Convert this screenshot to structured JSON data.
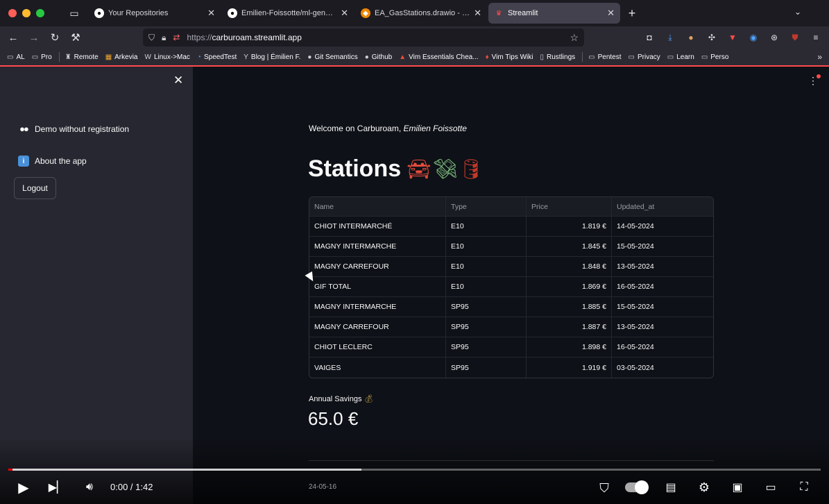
{
  "browser": {
    "tabs": [
      {
        "title": "Your Repositories",
        "icon": "github-icon",
        "active": false
      },
      {
        "title": "Emilien-Foissotte/ml-genetics-a",
        "icon": "github-icon",
        "active": false
      },
      {
        "title": "EA_GasStations.drawio - draw.io",
        "icon": "drawio-icon",
        "active": false
      },
      {
        "title": "Streamlit",
        "icon": "streamlit-icon",
        "active": true
      }
    ],
    "url_protocol": "https://",
    "url_host": "carburoam.streamlit.app",
    "bookmarks": [
      "AL",
      "Pro",
      "Remote",
      "Arkevia",
      "Linux->Mac",
      "SpeedTest",
      "Blog | Émilien F.",
      "Git Semantics",
      "Github",
      "Vim Essentials Chea...",
      "Vim Tips Wiki",
      "Rustlings",
      "Pentest",
      "Privacy",
      "Learn",
      "Perso"
    ],
    "extension_badge": "3"
  },
  "sidebar": {
    "items": [
      {
        "label": "Demo without registration",
        "icon": "eyes-icon"
      },
      {
        "label": "About the app",
        "icon": "info-icon"
      }
    ],
    "logout_label": "Logout"
  },
  "main": {
    "welcome_prefix": "Welcome on Carburoam, ",
    "welcome_name": "Emilien Foissotte",
    "title": "Stations",
    "table": {
      "headers": [
        "Name",
        "Type",
        "Price",
        "Updated_at"
      ],
      "rows": [
        [
          "CHIOT INTERMARCHÉ",
          "E10",
          "1.819 €",
          "14-05-2024"
        ],
        [
          "MAGNY INTERMARCHE",
          "E10",
          "1.845 €",
          "15-05-2024"
        ],
        [
          "MAGNY CARREFOUR",
          "E10",
          "1.848 €",
          "13-05-2024"
        ],
        [
          "GIF TOTAL",
          "E10",
          "1.869 €",
          "16-05-2024"
        ],
        [
          "MAGNY INTERMARCHE",
          "SP95",
          "1.885 €",
          "15-05-2024"
        ],
        [
          "MAGNY CARREFOUR",
          "SP95",
          "1.887 €",
          "13-05-2024"
        ],
        [
          "CHIOT LECLERC",
          "SP95",
          "1.898 €",
          "16-05-2024"
        ],
        [
          "VAIGES",
          "SP95",
          "1.919 €",
          "03-05-2024"
        ]
      ]
    },
    "savings_label": "Annual Savings",
    "savings_value": "65.0 €",
    "date_text": "24-05-16"
  },
  "video": {
    "time": "0:00 / 1:42",
    "progress_played": 0.005,
    "progress_buffered": 0.435
  }
}
